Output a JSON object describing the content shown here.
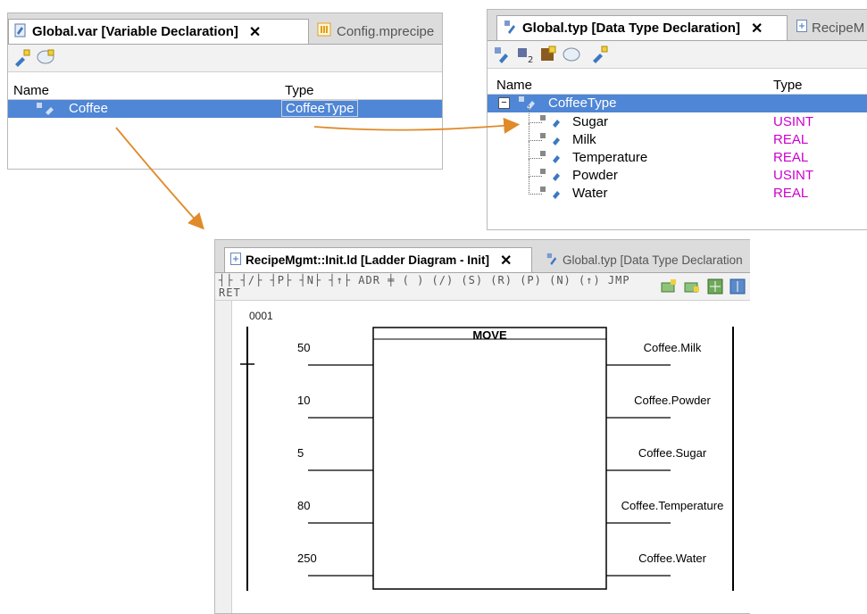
{
  "var_panel": {
    "tab_active": "Global.var [Variable Declaration]",
    "tab_close": "✕",
    "tab_inactive": "Config.mprecipe",
    "col_name": "Name",
    "col_type": "Type",
    "row": {
      "name": "Coffee",
      "type": "CoffeeType"
    }
  },
  "typ_panel": {
    "tab_active": "Global.typ [Data Type Declaration]",
    "tab_close": "✕",
    "tab_inactive": "RecipeM",
    "col_name": "Name",
    "col_type": "Type",
    "expand_symbol": "−",
    "type_row": "CoffeeType",
    "members": [
      {
        "name": "Sugar",
        "type": "USINT"
      },
      {
        "name": "Milk",
        "type": "REAL"
      },
      {
        "name": "Temperature",
        "type": "REAL"
      },
      {
        "name": "Powder",
        "type": "USINT"
      },
      {
        "name": "Water",
        "type": "REAL"
      }
    ]
  },
  "ladder_panel": {
    "tab_active": "RecipeMgmt::Init.ld [Ladder Diagram - Init]",
    "tab_close": "✕",
    "tab_inactive": "Global.typ [Data Type Declaration",
    "toolbar_glyphs": "┤├ ┤/├ ┤P├ ┤N├ ┤↑├ ADR ╪ ( ) (/) (S) (R) (P) (N) (↑) JMP RET",
    "rung_number": "0001",
    "block_title": "MOVE",
    "inputs": [
      "50",
      "10",
      "5",
      "80",
      "250"
    ],
    "outputs": [
      "Coffee.Milk",
      "Coffee.Powder",
      "Coffee.Sugar",
      "Coffee.Temperature",
      "Coffee.Water"
    ]
  },
  "colors": {
    "selection": "#4f86d6",
    "arrow": "#e08a2a",
    "type_text": "#cc00cc",
    "tab_bar": "#dcdcdc"
  }
}
